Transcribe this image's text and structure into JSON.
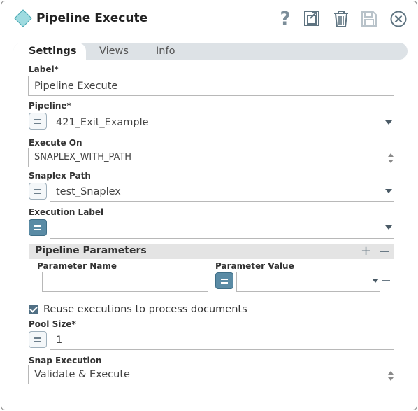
{
  "window": {
    "title": "Pipeline Execute"
  },
  "toolbar": {
    "help_icon": "question-icon",
    "export_icon": "export-icon",
    "delete_icon": "trash-icon",
    "save_icon": "save-icon",
    "close_icon": "close-icon"
  },
  "tabs": [
    {
      "label": "Settings",
      "active": true
    },
    {
      "label": "Views",
      "active": false
    },
    {
      "label": "Info",
      "active": false
    }
  ],
  "fields": {
    "label": {
      "label": "Label*",
      "value": "Pipeline Execute"
    },
    "pipeline": {
      "label": "Pipeline*",
      "value": "421_Exit_Example"
    },
    "execute_on": {
      "label": "Execute On",
      "value": "SNAPLEX_WITH_PATH"
    },
    "snaplex_path": {
      "label": "Snaplex Path",
      "value": "test_Snaplex"
    },
    "execution_label": {
      "label": "Execution Label",
      "value": ""
    },
    "pipeline_parameters": {
      "title": "Pipeline Parameters",
      "col_name": "Parameter Name",
      "col_value": "Parameter Value",
      "rows": [
        {
          "name": "",
          "value": ""
        }
      ]
    },
    "reuse": {
      "label": "Reuse executions to process documents",
      "checked": true
    },
    "pool_size": {
      "label": "Pool Size*",
      "value": "1"
    },
    "snap_execution": {
      "label": "Snap Execution",
      "value": "Validate & Execute"
    }
  },
  "colors": {
    "accent": "#5a8ba5",
    "tab_bar": "#dde2e6",
    "section_bar": "#e4e4e4"
  }
}
